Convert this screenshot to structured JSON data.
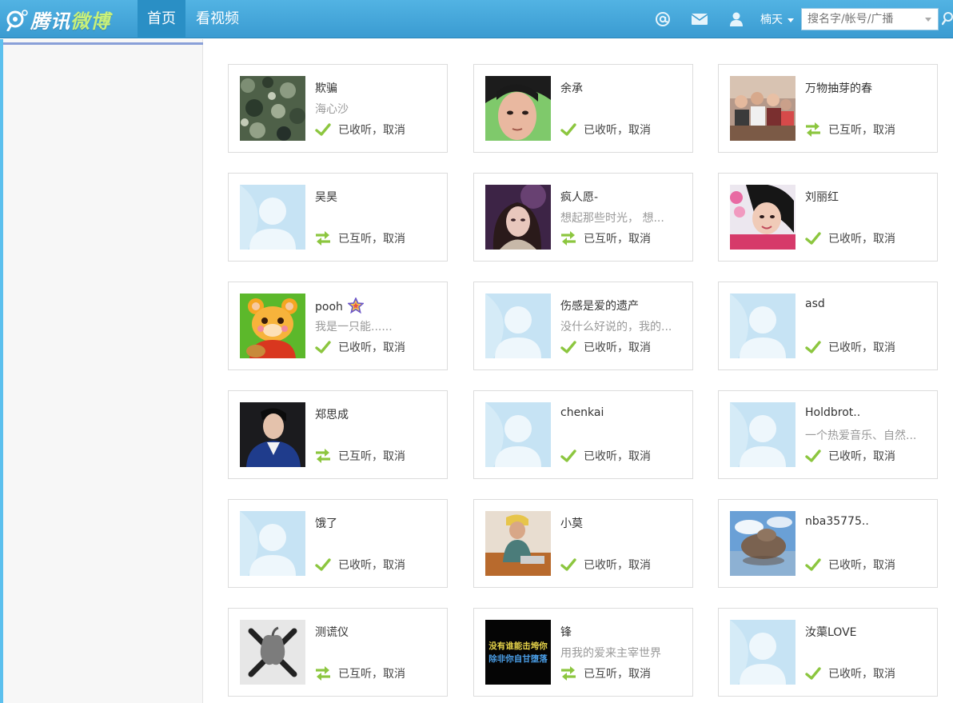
{
  "header": {
    "logo_text_a": "腾讯",
    "logo_text_b": "微博",
    "nav": [
      "首页",
      "看视频"
    ],
    "user_name": "楠天",
    "search_placeholder": "搜名字/帐号/广播",
    "icons": [
      "at-icon",
      "mail-icon",
      "user-icon",
      "chevron-down-icon",
      "search-icon"
    ]
  },
  "status_labels": {
    "following": "已收听，取消",
    "mutual": "已互听，取消"
  },
  "cards": [
    {
      "name": "欺骗",
      "bio": "海心沙",
      "status": "following",
      "avatar": "camo"
    },
    {
      "name": "余承",
      "bio": "",
      "status": "following",
      "avatar": "boy-face"
    },
    {
      "name": "万物抽芽的春",
      "bio": "",
      "status": "mutual",
      "avatar": "group-photo"
    },
    {
      "name": "吴昊",
      "bio": "",
      "status": "mutual",
      "avatar": "default"
    },
    {
      "name": "疯人愿-",
      "bio": "想起那些时光， 想...",
      "status": "mutual",
      "avatar": "purple-girl"
    },
    {
      "name": "刘丽红",
      "bio": "",
      "status": "following",
      "avatar": "girl-flowers"
    },
    {
      "name": "pooh",
      "bio": "我是一只能......",
      "status": "following",
      "avatar": "bear",
      "badge": "star-icon"
    },
    {
      "name": "伤感是爱的遗产",
      "bio": "没什么好说的，我的...",
      "status": "following",
      "avatar": "default"
    },
    {
      "name": "asd",
      "bio": "",
      "status": "following",
      "avatar": "default"
    },
    {
      "name": "郑思成",
      "bio": "",
      "status": "mutual",
      "avatar": "man-blue"
    },
    {
      "name": "chenkai",
      "bio": "",
      "status": "following",
      "avatar": "default"
    },
    {
      "name": "Holdbrot..",
      "bio": "一个热爱音乐、自然...",
      "status": "following",
      "avatar": "default"
    },
    {
      "name": "饿了",
      "bio": "",
      "status": "following",
      "avatar": "default"
    },
    {
      "name": "小莫",
      "bio": "",
      "status": "following",
      "avatar": "man-chair"
    },
    {
      "name": "nba35775..",
      "bio": "",
      "status": "following",
      "avatar": "rock"
    },
    {
      "name": "测谎仪",
      "bio": "",
      "status": "mutual",
      "avatar": "apple-skull"
    },
    {
      "name": "锋",
      "bio": "用我的爱来主宰世界",
      "status": "mutual",
      "avatar": "text-image"
    },
    {
      "name": "汝蕖LOVE",
      "bio": "",
      "status": "following",
      "avatar": "default"
    }
  ],
  "avatar_texts": {
    "text_image": [
      "没有谁能击垮你",
      "除非你自甘堕落"
    ]
  },
  "colors": {
    "header_blue": "#3da2d8",
    "check_green": "#8cc63f",
    "default_avatar_bg": "#c6e3f4"
  }
}
